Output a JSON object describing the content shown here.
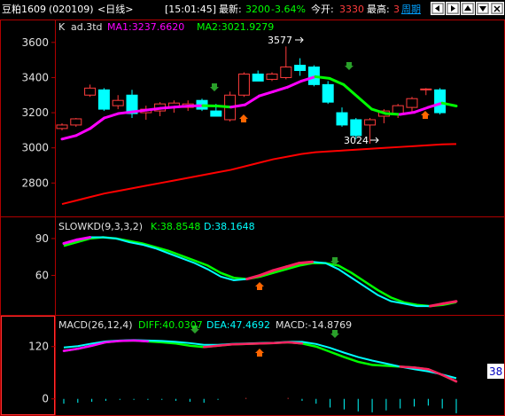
{
  "header": {
    "symbol": "豆粕1609",
    "code": "(020109)",
    "period": "<日线>",
    "time": "[15:01:45]",
    "latest_label": "最新:",
    "latest_value": "3200",
    "change_pct": "-3.64%",
    "open_label": "今开:",
    "open_value": "3330",
    "high_label": "最高:",
    "high_value": "3",
    "week_label": "周期"
  },
  "panel_main": {
    "k_label": "K",
    "series_label": "ad.3td",
    "ma1": "MA1:3237.6620",
    "ma2": "MA2:3021.9279",
    "y_ticks": [
      "3600",
      "3400",
      "3200",
      "3000",
      "2800"
    ],
    "y_tick_values": [
      3600,
      3400,
      3200,
      3000,
      2800
    ],
    "ylim": [
      2640,
      3700
    ],
    "high_note": "3577",
    "low_note": "3024"
  },
  "panel_kd": {
    "label": "SLOWKD(9,3,3,2)",
    "k": "K:38.8548",
    "d": "D:38.1648",
    "y_ticks": [
      "90",
      "60"
    ],
    "y_tick_values": [
      90,
      60
    ],
    "ylim": [
      30,
      95
    ]
  },
  "panel_macd": {
    "label": "MACD(26,12,4)",
    "diff": "DIFF:40.0307",
    "dea": "DEA:47.4692",
    "macd": "MACD:-14.8769",
    "y_ticks": [
      "120",
      "0"
    ],
    "y_tick_values": [
      120,
      0
    ],
    "ylim": [
      -25,
      150
    ],
    "badge": "38"
  },
  "colors": {
    "up": "#ff3c3c",
    "down": "#00ffff",
    "ma1_up": "#ff00ff",
    "ma1_down": "#00ff00",
    "ma2": "#ff0000",
    "axis": "#b00000",
    "label_white": "#e0e0e0",
    "diff": "#00ff00",
    "dea": "#00ffff",
    "yellow": "#ffff00",
    "arrow_green": "#2aa02a",
    "arrow_orange": "#ff6600"
  },
  "chart_data": [
    {
      "type": "candlestick",
      "title": "",
      "ylim": [
        2640,
        3700
      ],
      "candles": [
        {
          "o": 3110,
          "h": 3140,
          "l": 3100,
          "c": 3130
        },
        {
          "o": 3130,
          "h": 3170,
          "l": 3120,
          "c": 3165
        },
        {
          "o": 3300,
          "h": 3360,
          "l": 3290,
          "c": 3340
        },
        {
          "o": 3330,
          "h": 3340,
          "l": 3210,
          "c": 3220
        },
        {
          "o": 3240,
          "h": 3300,
          "l": 3220,
          "c": 3270
        },
        {
          "o": 3300,
          "h": 3330,
          "l": 3170,
          "c": 3195
        },
        {
          "o": 3200,
          "h": 3240,
          "l": 3160,
          "c": 3220
        },
        {
          "o": 3210,
          "h": 3260,
          "l": 3180,
          "c": 3250
        },
        {
          "o": 3230,
          "h": 3270,
          "l": 3200,
          "c": 3255
        },
        {
          "o": 3230,
          "h": 3270,
          "l": 3210,
          "c": 3250
        },
        {
          "o": 3270,
          "h": 3280,
          "l": 3210,
          "c": 3220
        },
        {
          "o": 3210,
          "h": 3250,
          "l": 3180,
          "c": 3180
        },
        {
          "o": 3160,
          "h": 3320,
          "l": 3150,
          "c": 3300
        },
        {
          "o": 3300,
          "h": 3430,
          "l": 3290,
          "c": 3420
        },
        {
          "o": 3420,
          "h": 3440,
          "l": 3380,
          "c": 3380
        },
        {
          "o": 3390,
          "h": 3430,
          "l": 3380,
          "c": 3420
        },
        {
          "o": 3400,
          "h": 3577,
          "l": 3390,
          "c": 3460
        },
        {
          "o": 3470,
          "h": 3510,
          "l": 3410,
          "c": 3440
        },
        {
          "o": 3460,
          "h": 3470,
          "l": 3350,
          "c": 3360
        },
        {
          "o": 3360,
          "h": 3380,
          "l": 3250,
          "c": 3260
        },
        {
          "o": 3200,
          "h": 3230,
          "l": 3120,
          "c": 3130
        },
        {
          "o": 3160,
          "h": 3170,
          "l": 3050,
          "c": 3070
        },
        {
          "o": 3130,
          "h": 3170,
          "l": 3024,
          "c": 3160
        },
        {
          "o": 3180,
          "h": 3220,
          "l": 3140,
          "c": 3210
        },
        {
          "o": 3190,
          "h": 3250,
          "l": 3170,
          "c": 3240
        },
        {
          "o": 3230,
          "h": 3290,
          "l": 3200,
          "c": 3280
        },
        {
          "o": 3330,
          "h": 3340,
          "l": 3300,
          "c": 3335
        },
        {
          "o": 3330,
          "h": 3340,
          "l": 3190,
          "c": 3200
        }
      ],
      "ma1": [
        3050,
        3070,
        3110,
        3170,
        3195,
        3205,
        3215,
        3225,
        3232,
        3238,
        3240,
        3238,
        3232,
        3245,
        3295,
        3320,
        3345,
        3380,
        3405,
        3395,
        3360,
        3290,
        3220,
        3195,
        3190,
        3202,
        3230,
        3255,
        3238
      ],
      "ma2": [
        2680,
        2700,
        2720,
        2740,
        2755,
        2770,
        2785,
        2800,
        2815,
        2830,
        2845,
        2860,
        2875,
        2895,
        2915,
        2935,
        2950,
        2965,
        2975,
        2980,
        2985,
        2990,
        2995,
        3000,
        3005,
        3010,
        3015,
        3020,
        3022
      ]
    },
    {
      "type": "line",
      "title": "SLOWKD(9,3,3,2)",
      "ylim": [
        30,
        95
      ],
      "series": [
        {
          "name": "K",
          "values": [
            86,
            89,
            91,
            91,
            90,
            87,
            85,
            82,
            78,
            74,
            70,
            65,
            59,
            56,
            57,
            60,
            64,
            67,
            70,
            71,
            70,
            65,
            58,
            51,
            44,
            39,
            37,
            35,
            35,
            37,
            38.85
          ]
        },
        {
          "name": "D",
          "values": [
            84,
            87,
            90,
            91,
            90,
            88,
            86,
            83,
            80,
            76,
            72,
            68,
            62,
            58,
            57,
            59,
            62,
            65,
            68,
            70,
            70,
            68,
            62,
            55,
            48,
            42,
            38,
            36,
            35,
            36,
            38.16
          ]
        }
      ]
    },
    {
      "type": "line",
      "title": "MACD(26,12,4)",
      "ylim": [
        -25,
        150
      ],
      "series": [
        {
          "name": "DIFF",
          "values": [
            110,
            115,
            122,
            130,
            133,
            134,
            132,
            130,
            127,
            122,
            119,
            122,
            125,
            126,
            127,
            128,
            130,
            127,
            120,
            108,
            96,
            85,
            78,
            76,
            74,
            72,
            68,
            55,
            40
          ]
        },
        {
          "name": "DEA",
          "values": [
            118,
            121,
            127,
            132,
            134,
            135,
            134,
            133,
            131,
            128,
            124,
            124,
            126,
            127,
            128,
            129,
            131,
            131,
            126,
            117,
            106,
            96,
            88,
            81,
            74,
            68,
            63,
            56,
            47.5
          ]
        },
        {
          "name": "MACD",
          "values": [
            -5,
            -4,
            -3,
            -2,
            -1,
            -1,
            -1,
            -1,
            -2,
            -3,
            -4,
            -1,
            0,
            1,
            0,
            0,
            1,
            -2,
            -5,
            -9,
            -11,
            -13,
            -14,
            -12,
            -10,
            -8,
            -7,
            -10,
            -14.9
          ]
        }
      ]
    }
  ]
}
